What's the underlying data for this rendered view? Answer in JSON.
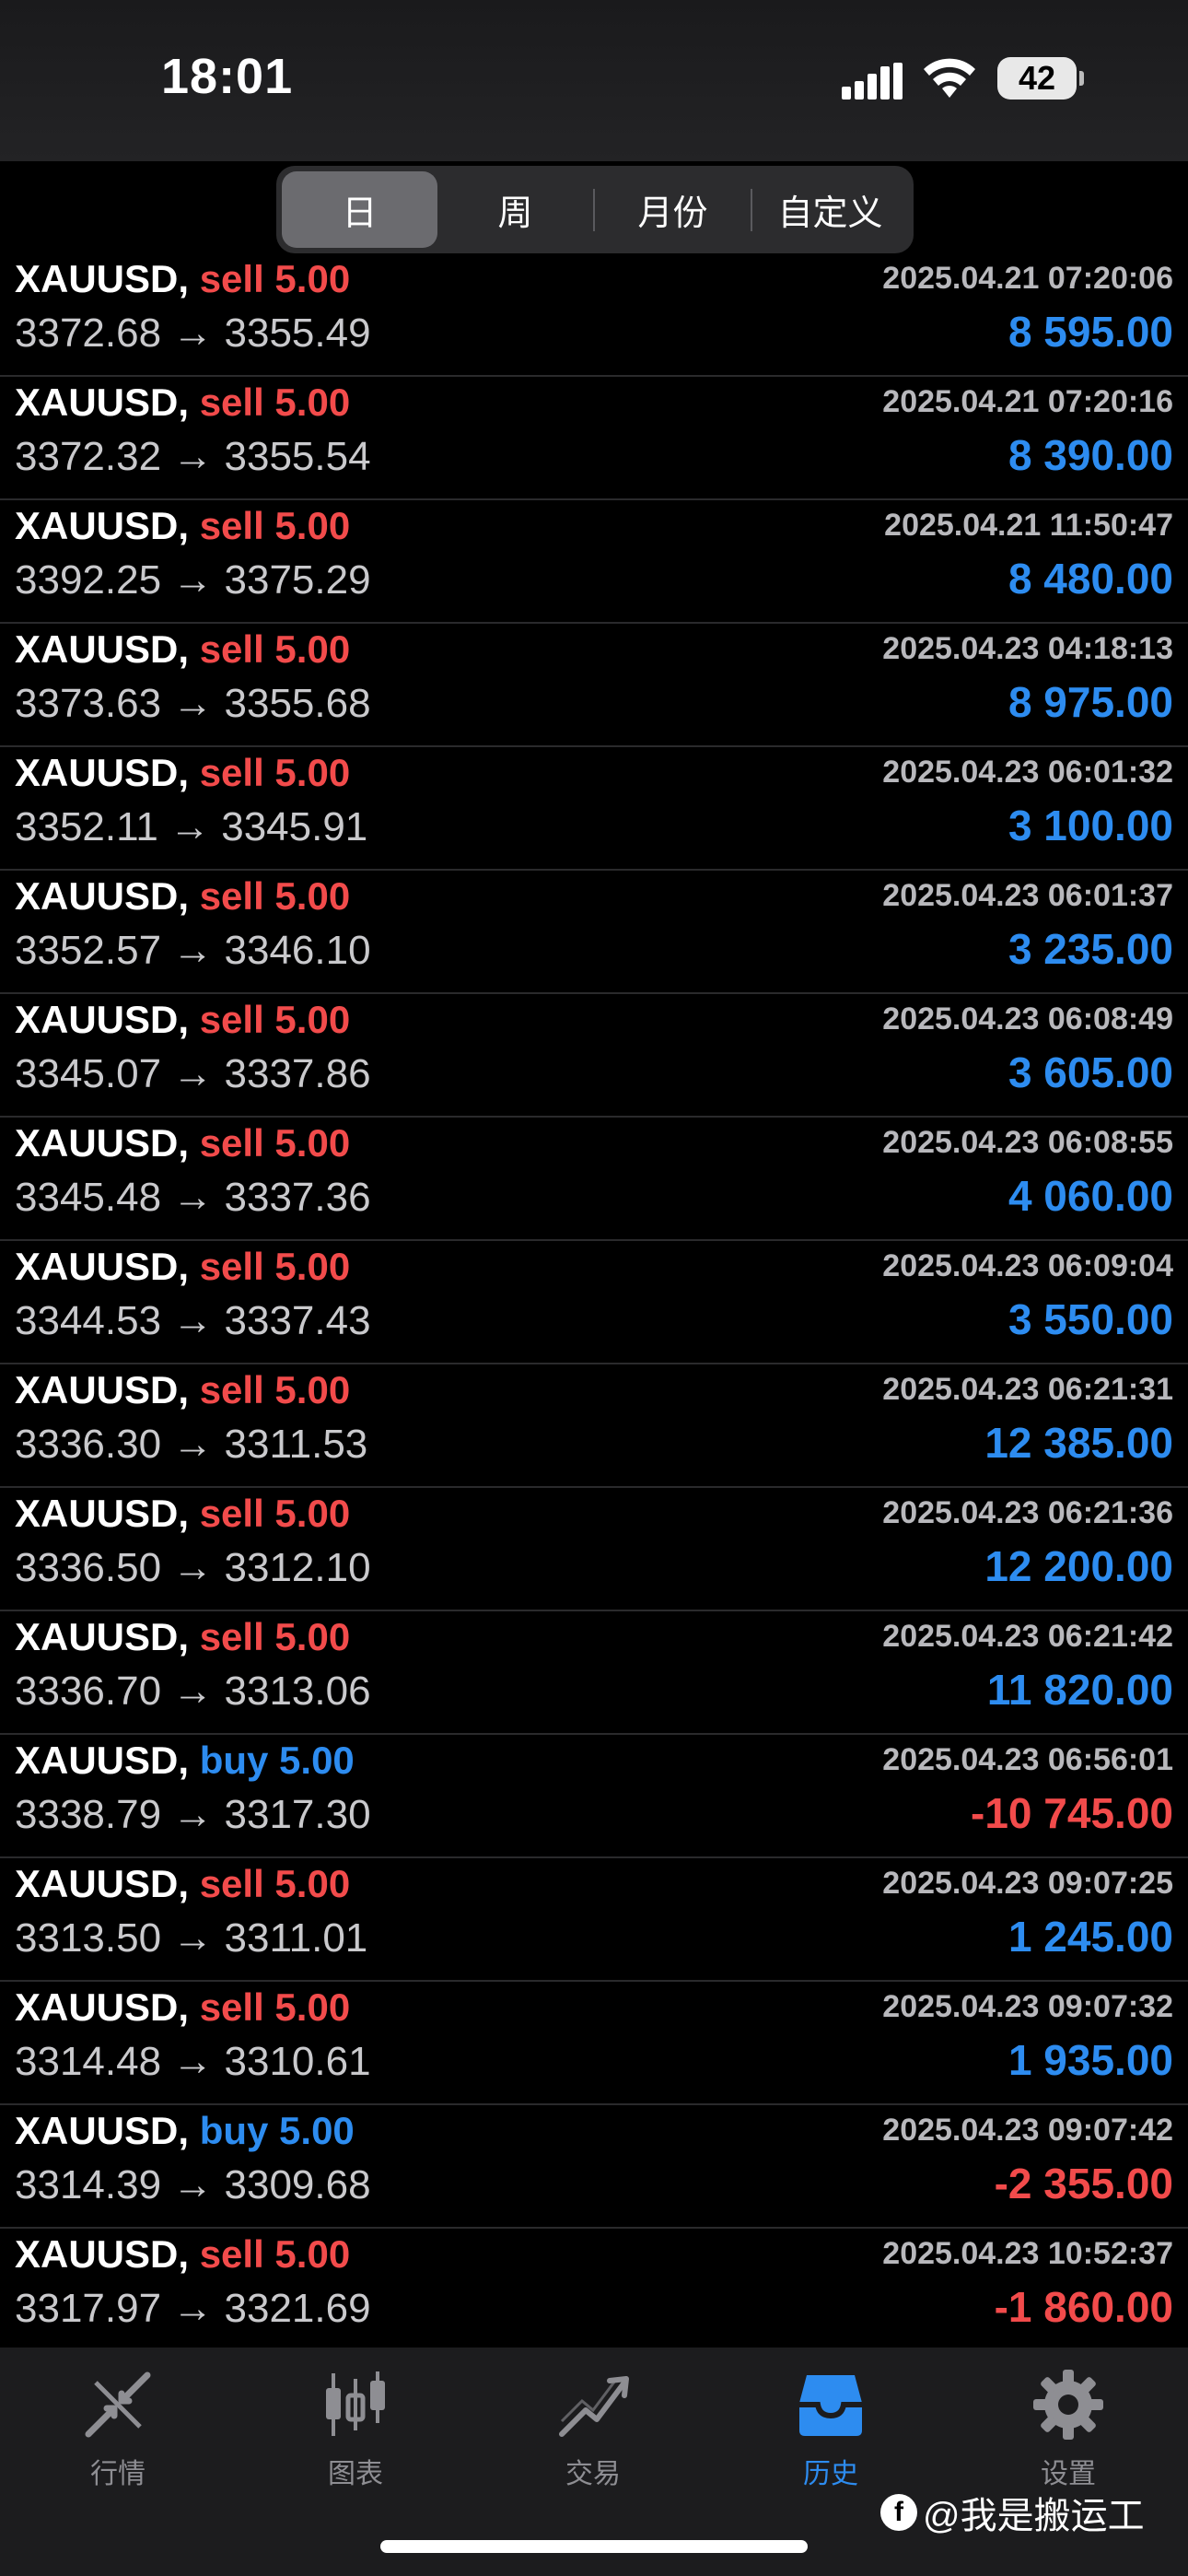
{
  "status_bar": {
    "time": "18:01",
    "battery": "42"
  },
  "segments": [
    {
      "label": "日",
      "active": true
    },
    {
      "label": "周",
      "active": false
    },
    {
      "label": "月份",
      "active": false
    },
    {
      "label": "自定义",
      "active": false
    }
  ],
  "trades": [
    {
      "symbol": "XAUUSD,",
      "side": "sell 5.00",
      "side_type": "sell",
      "time": "2025.04.21 07:20:06",
      "prices": "3372.68 → 3355.49",
      "profit": "8 595.00",
      "sign": "pos"
    },
    {
      "symbol": "XAUUSD,",
      "side": "sell 5.00",
      "side_type": "sell",
      "time": "2025.04.21 07:20:16",
      "prices": "3372.32 → 3355.54",
      "profit": "8 390.00",
      "sign": "pos"
    },
    {
      "symbol": "XAUUSD,",
      "side": "sell 5.00",
      "side_type": "sell",
      "time": "2025.04.21 11:50:47",
      "prices": "3392.25 → 3375.29",
      "profit": "8 480.00",
      "sign": "pos"
    },
    {
      "symbol": "XAUUSD,",
      "side": "sell 5.00",
      "side_type": "sell",
      "time": "2025.04.23 04:18:13",
      "prices": "3373.63 → 3355.68",
      "profit": "8 975.00",
      "sign": "pos"
    },
    {
      "symbol": "XAUUSD,",
      "side": "sell 5.00",
      "side_type": "sell",
      "time": "2025.04.23 06:01:32",
      "prices": "3352.11 → 3345.91",
      "profit": "3 100.00",
      "sign": "pos"
    },
    {
      "symbol": "XAUUSD,",
      "side": "sell 5.00",
      "side_type": "sell",
      "time": "2025.04.23 06:01:37",
      "prices": "3352.57 → 3346.10",
      "profit": "3 235.00",
      "sign": "pos"
    },
    {
      "symbol": "XAUUSD,",
      "side": "sell 5.00",
      "side_type": "sell",
      "time": "2025.04.23 06:08:49",
      "prices": "3345.07 → 3337.86",
      "profit": "3 605.00",
      "sign": "pos"
    },
    {
      "symbol": "XAUUSD,",
      "side": "sell 5.00",
      "side_type": "sell",
      "time": "2025.04.23 06:08:55",
      "prices": "3345.48 → 3337.36",
      "profit": "4 060.00",
      "sign": "pos"
    },
    {
      "symbol": "XAUUSD,",
      "side": "sell 5.00",
      "side_type": "sell",
      "time": "2025.04.23 06:09:04",
      "prices": "3344.53 → 3337.43",
      "profit": "3 550.00",
      "sign": "pos"
    },
    {
      "symbol": "XAUUSD,",
      "side": "sell 5.00",
      "side_type": "sell",
      "time": "2025.04.23 06:21:31",
      "prices": "3336.30 → 3311.53",
      "profit": "12 385.00",
      "sign": "pos"
    },
    {
      "symbol": "XAUUSD,",
      "side": "sell 5.00",
      "side_type": "sell",
      "time": "2025.04.23 06:21:36",
      "prices": "3336.50 → 3312.10",
      "profit": "12 200.00",
      "sign": "pos"
    },
    {
      "symbol": "XAUUSD,",
      "side": "sell 5.00",
      "side_type": "sell",
      "time": "2025.04.23 06:21:42",
      "prices": "3336.70 → 3313.06",
      "profit": "11 820.00",
      "sign": "pos"
    },
    {
      "symbol": "XAUUSD,",
      "side": "buy 5.00",
      "side_type": "buy",
      "time": "2025.04.23 06:56:01",
      "prices": "3338.79 → 3317.30",
      "profit": "-10 745.00",
      "sign": "neg"
    },
    {
      "symbol": "XAUUSD,",
      "side": "sell 5.00",
      "side_type": "sell",
      "time": "2025.04.23 09:07:25",
      "prices": "3313.50 → 3311.01",
      "profit": "1 245.00",
      "sign": "pos"
    },
    {
      "symbol": "XAUUSD,",
      "side": "sell 5.00",
      "side_type": "sell",
      "time": "2025.04.23 09:07:32",
      "prices": "3314.48 → 3310.61",
      "profit": "1 935.00",
      "sign": "pos"
    },
    {
      "symbol": "XAUUSD,",
      "side": "buy 5.00",
      "side_type": "buy",
      "time": "2025.04.23 09:07:42",
      "prices": "3314.39 → 3309.68",
      "profit": "-2 355.00",
      "sign": "neg"
    },
    {
      "symbol": "XAUUSD,",
      "side": "sell 5.00",
      "side_type": "sell",
      "time": "2025.04.23 10:52:37",
      "prices": "3317.97 → 3321.69",
      "profit": "-1 860.00",
      "sign": "neg"
    }
  ],
  "tab_bar": {
    "quotes": "行情",
    "charts": "图表",
    "trade": "交易",
    "history": "历史",
    "settings": "设置"
  },
  "watermark": "@我是搬运工",
  "colors": {
    "sell": "#f24b4b",
    "buy": "#2d8cf0",
    "profit": "#2d8cf0",
    "loss": "#f24b4b"
  }
}
